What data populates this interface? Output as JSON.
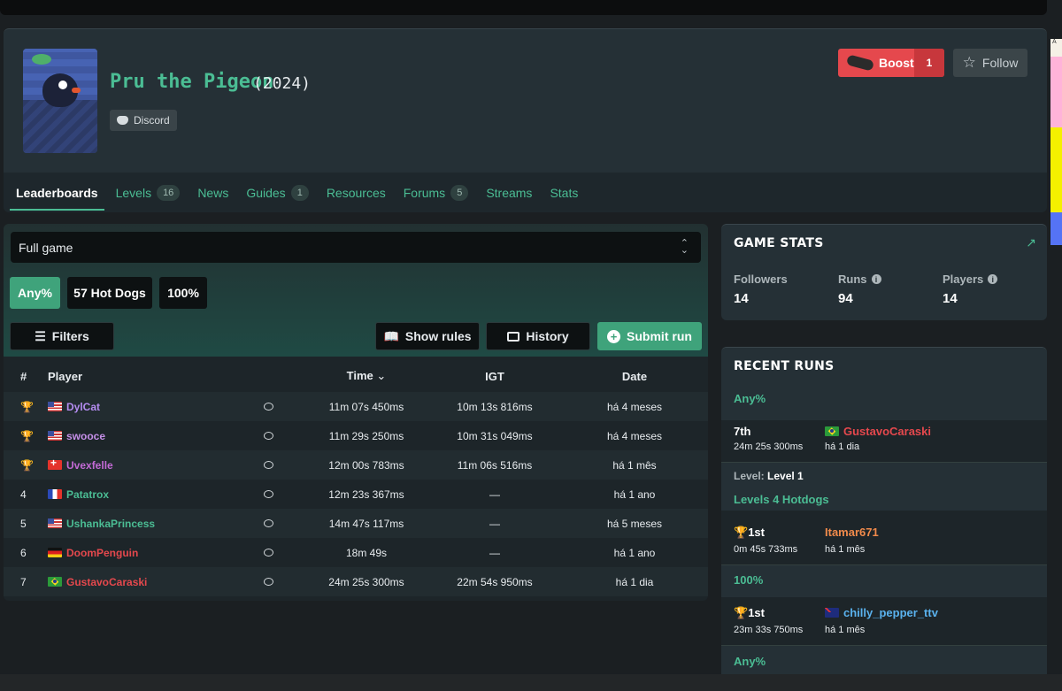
{
  "game": {
    "title": "Pru the Pigeon",
    "year": "(2024)",
    "discord_label": "Discord",
    "boost_label": "Boost",
    "boost_count": "1",
    "follow_label": "Follow"
  },
  "tabs": [
    {
      "label": "Leaderboards",
      "badge": ""
    },
    {
      "label": "Levels",
      "badge": "16"
    },
    {
      "label": "News",
      "badge": ""
    },
    {
      "label": "Guides",
      "badge": "1"
    },
    {
      "label": "Resources",
      "badge": ""
    },
    {
      "label": "Forums",
      "badge": "5"
    },
    {
      "label": "Streams",
      "badge": ""
    },
    {
      "label": "Stats",
      "badge": ""
    }
  ],
  "leaderboard": {
    "selected_mode": "Full game",
    "categories": [
      "Any%",
      "57 Hot Dogs",
      "100%"
    ],
    "filters_label": "Filters",
    "show_rules_label": "Show rules",
    "history_label": "History",
    "submit_label": "Submit run",
    "columns": {
      "rank": "#",
      "player": "Player",
      "time": "Time",
      "igt": "IGT",
      "date": "Date"
    },
    "rows": [
      {
        "rank": "",
        "player": "DylCat",
        "flag": "us",
        "color": "#b48cf0",
        "time": "11m 07s 450ms",
        "igt": "10m 13s 816ms",
        "date": "há 4 meses"
      },
      {
        "rank": "",
        "player": "swooce",
        "flag": "us",
        "color": "#c58fe8",
        "time": "11m 29s 250ms",
        "igt": "10m 31s 049ms",
        "date": "há 4 meses"
      },
      {
        "rank": "",
        "player": "Uvexfelle",
        "flag": "ch",
        "color": "#c36ad6",
        "time": "12m 00s 783ms",
        "igt": "11m 06s 516ms",
        "date": "há 1 mês"
      },
      {
        "rank": "4",
        "player": "Patatrox",
        "flag": "fr",
        "color": "#4bbd94",
        "time": "12m 23s 367ms",
        "igt": "—",
        "date": "há 1 ano"
      },
      {
        "rank": "5",
        "player": "UshankaPrincess",
        "flag": "us",
        "color": "#4bbd94",
        "time": "14m 47s 117ms",
        "igt": "—",
        "date": "há 5 meses"
      },
      {
        "rank": "6",
        "player": "DoomPenguin",
        "flag": "de",
        "color": "#e5484d",
        "time": "18m 49s",
        "igt": "—",
        "date": "há 1 ano"
      },
      {
        "rank": "7",
        "player": "GustavoCaraski",
        "flag": "br",
        "color": "#e5484d",
        "time": "24m 25s 300ms",
        "igt": "22m 54s 950ms",
        "date": "há 1 dia"
      }
    ]
  },
  "game_stats": {
    "title": "GAME STATS",
    "followers_label": "Followers",
    "followers": "14",
    "runs_label": "Runs",
    "runs": "94",
    "players_label": "Players",
    "players": "14"
  },
  "recent_runs": {
    "title": "RECENT RUNS",
    "items": [
      {
        "category": "Any%",
        "place": "7th",
        "time": "24m 25s 300ms",
        "player": "GustavoCaraski",
        "date": "há 1 dia"
      },
      {
        "level_prefix": "Level:",
        "level": "Level 1",
        "category": "Levels 4 Hotdogs",
        "place": "1st",
        "time": "0m 45s 733ms",
        "player": "Itamar671",
        "date": "há 1 mês"
      },
      {
        "category": "100%",
        "place": "1st",
        "time": "23m 33s 750ms",
        "player": "chilly_pepper_ttv",
        "date": "há 1 mês"
      },
      {
        "category": "Any%"
      }
    ]
  },
  "colors": {
    "accent": "#4bbd94",
    "boost": "#e5484d",
    "panel": "#253036"
  }
}
